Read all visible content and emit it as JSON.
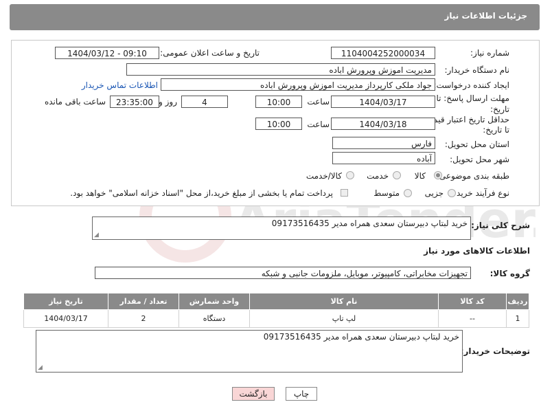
{
  "header": {
    "title": "جزئیات اطلاعات نیاز"
  },
  "need_number": {
    "label": "شماره نیاز:",
    "value": "1104004252000034"
  },
  "announce": {
    "label": "تاریخ و ساعت اعلان عمومی:",
    "value": "1404/03/12 - 09:10"
  },
  "buyer_org": {
    "label": "نام دستگاه خریدار:",
    "value": "مدیریت اموزش وپرورش اباده"
  },
  "requester": {
    "label": "ایجاد کننده درخواست:",
    "value": "جواد ملکی کارپرداز مدیریت اموزش وپرورش اباده",
    "contact_link": "اطلاعات تماس خریدار"
  },
  "deadline": {
    "label_line1": "مهلت ارسال پاسخ: تا",
    "label_line2": "تاریخ:",
    "date": "1404/03/17",
    "time_label": "ساعت",
    "time": "10:00",
    "days": "4",
    "days_label": "روز و",
    "remaining": "23:35:00",
    "remaining_label": "ساعت باقی مانده"
  },
  "price_validity": {
    "label_line1": "حداقل تاریخ اعتبار قیمت:",
    "label_line2": "تا تاریخ:",
    "date": "1404/03/18",
    "time_label": "ساعت",
    "time": "10:00"
  },
  "province": {
    "label": "استان محل تحویل:",
    "value": "فارس"
  },
  "city": {
    "label": "شهر محل تحویل:",
    "value": "آباده"
  },
  "category": {
    "label": "طبقه بندی موضوعی:",
    "options": [
      "کالا",
      "خدمت",
      "کالا/خدمت"
    ],
    "selected": "کالا"
  },
  "process": {
    "label": "نوع فرآیند خرید :",
    "options": [
      "جزیی",
      "متوسط"
    ],
    "selected": "جزیی",
    "payment_note": "پرداخت تمام یا بخشی از مبلغ خرید،از محل \"اسناد خزانه اسلامی\" خواهد بود."
  },
  "summary": {
    "label": "شرح کلی نیاز:",
    "value": "خرید لبتاپ دبیرستان سعدی همراه مدیر 09173516435"
  },
  "goods_section": {
    "title": "اطلاعات کالاهای مورد نیاز"
  },
  "goods_group": {
    "label": "گروه کالا:",
    "value": "تجهیزات مخابراتی، کامپیوتر، موبایل، ملزومات جانبی و شبکه"
  },
  "table": {
    "headers": [
      "ردیف",
      "کد کالا",
      "نام کالا",
      "واحد شمارش",
      "تعداد / مقدار",
      "تاریخ نیاز"
    ],
    "rows": [
      [
        "1",
        "--",
        "لپ تاپ",
        "دستگاه",
        "2",
        "1404/03/17"
      ]
    ]
  },
  "buyer_notes": {
    "label": "توضیحات خریدار:",
    "value": "خرید لبتاپ دبیرستان سعدی همراه مدیر 09173516435"
  },
  "buttons": {
    "print": "چاپ",
    "back": "بازگشت"
  },
  "watermark": {
    "text": "AriaTender.net"
  }
}
